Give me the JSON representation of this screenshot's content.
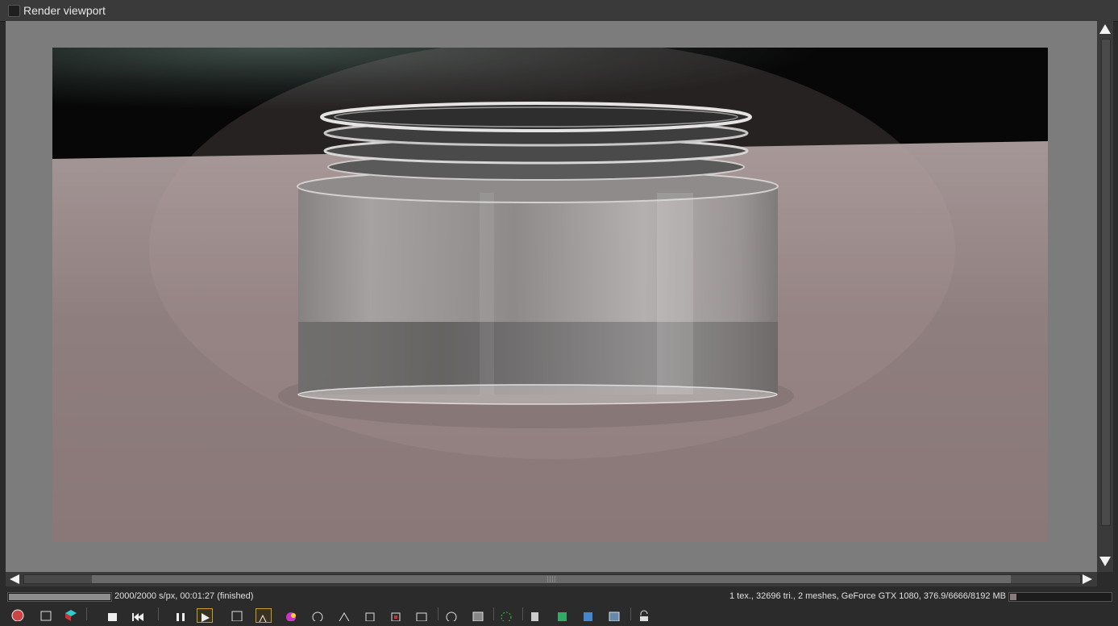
{
  "window": {
    "title": "Render viewport"
  },
  "status": {
    "progress_fraction": 1.0,
    "left_text": "2000/2000 s/px, 00:01:27 (finished)",
    "right_text": "1 tex., 32696 tri., 2 meshes, GeForce GTX 1080, 376.9/6666/8192 MB",
    "memory_fraction": 0.06
  },
  "toolbar": {
    "icons": [
      "revert-icon",
      "fit-icon",
      "color-cube-icon",
      "stop-icon",
      "restart-icon",
      "pause-icon",
      "play-icon",
      "save-icon",
      "pick-focus-icon",
      "color-picker-icon",
      "material-pick-icon",
      "region-icon",
      "object-pick-icon",
      "white-balance-icon",
      "focus-picker-icon",
      "camera-icon",
      "clay-icon",
      "spinner-icon",
      "copy-icon",
      "save-render-icon",
      "export-icon",
      "image-icon",
      "lock-icon"
    ],
    "active": [
      "play-icon",
      "pick-focus-icon"
    ]
  },
  "colors": {
    "panel": "#3a3a3a",
    "viewport_bg": "#7c7c7c",
    "accent_active": "#c89b2a"
  }
}
